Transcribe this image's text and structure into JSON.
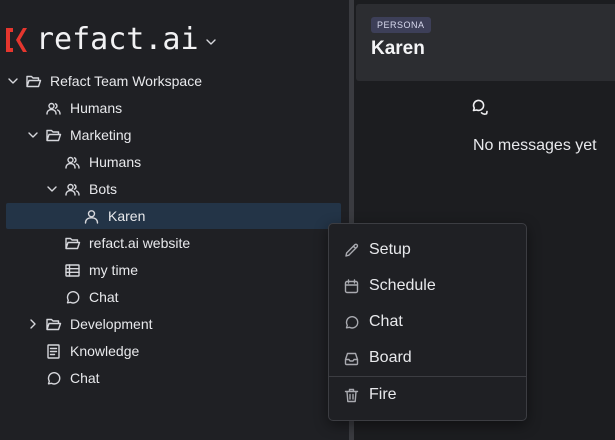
{
  "brand": {
    "logo_text": "refact.ai",
    "accent_color": "#e5362e"
  },
  "sidebar": {
    "items": [
      {
        "label": "Refact Team Workspace",
        "icon": "folder-open-icon",
        "expanded": true
      },
      {
        "label": "Humans",
        "icon": "users-icon"
      },
      {
        "label": "Marketing",
        "icon": "folder-open-icon",
        "expanded": true
      },
      {
        "label": "Humans",
        "icon": "users-icon"
      },
      {
        "label": "Bots",
        "icon": "users-icon",
        "expanded": true
      },
      {
        "label": "Karen",
        "icon": "user-icon",
        "selected": true
      },
      {
        "label": "refact.ai website",
        "icon": "folder-open-icon"
      },
      {
        "label": "my time",
        "icon": "table-icon"
      },
      {
        "label": "Chat",
        "icon": "chat-icon"
      },
      {
        "label": "Development",
        "icon": "folder-open-icon",
        "expanded": false
      },
      {
        "label": "Knowledge",
        "icon": "document-icon"
      },
      {
        "label": "Chat",
        "icon": "chat-icon"
      }
    ]
  },
  "persona": {
    "badge": "PERSONA",
    "name": "Karen"
  },
  "chat": {
    "empty_text": "No messages yet"
  },
  "context_menu": {
    "items": [
      {
        "label": "Setup",
        "icon": "pencil-icon"
      },
      {
        "label": "Schedule",
        "icon": "calendar-icon"
      },
      {
        "label": "Chat",
        "icon": "chat-icon"
      },
      {
        "label": "Board",
        "icon": "inbox-icon"
      },
      {
        "label": "Fire",
        "icon": "trash-icon"
      }
    ]
  }
}
